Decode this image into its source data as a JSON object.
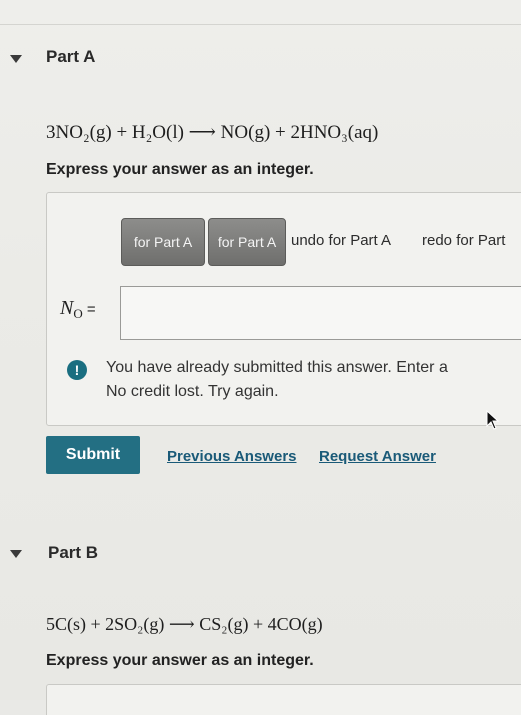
{
  "partA": {
    "title": "Part A",
    "equation": "3NO₂(g) + H₂O(l) ⟶ NO(g) + 2HNO₃(aq)",
    "instruction": "Express your answer as an integer.",
    "toolbar": {
      "btn1": "for Part A",
      "btn2": "for Part A",
      "undo": "undo for Part A",
      "redo": "redo for Part"
    },
    "answer_label": {
      "symbol": "N",
      "subscript": "O",
      "equals": " ="
    },
    "answer_value": "",
    "alert_line1": "You have already submitted this answer. Enter a",
    "alert_line2": "No credit lost. Try again.",
    "submit": "Submit",
    "previous_answers": "Previous Answers",
    "request_answer": "Request Answer"
  },
  "partB": {
    "title": "Part B",
    "equation": "5C(s) + 2SO₂(g) ⟶ CS₂(g) + 4CO(g)",
    "instruction": "Express your answer as an integer."
  },
  "colors": {
    "submit": "#236f83",
    "link": "#1a5a78",
    "alert_icon": "#1a6e80",
    "toolbar_button": "#7d7d7b"
  }
}
